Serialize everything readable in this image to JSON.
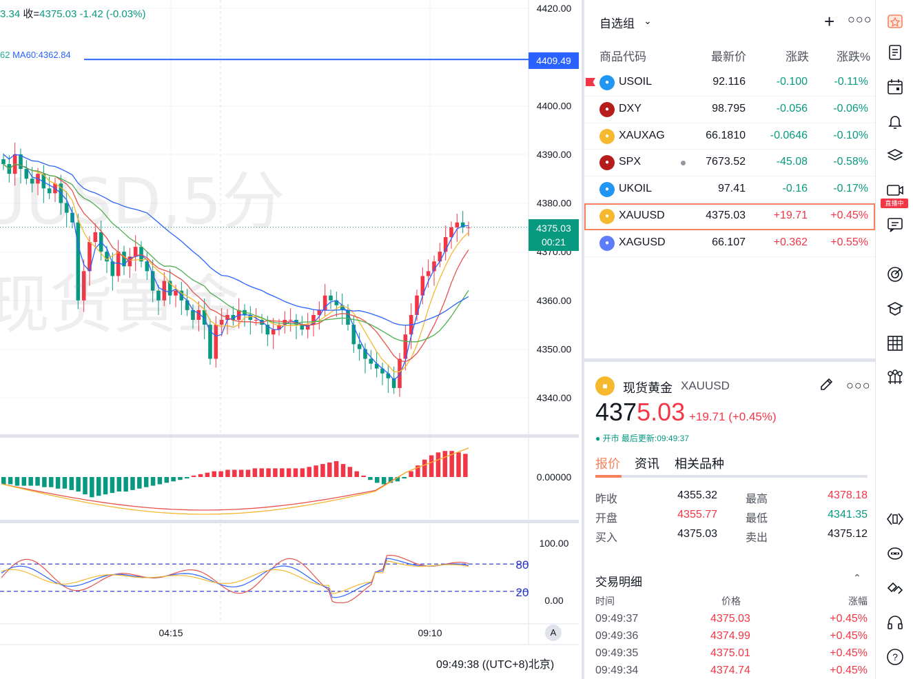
{
  "chart": {
    "legend_ohlc": "3.34 收=4375.03 -1.42 (-0.03%)",
    "legend_ohlc_parts": {
      "prefix": "3.34",
      "close_label": "收=",
      "close": "4375.03",
      "change": "-1.42",
      "change_pct": "(-0.03%)"
    },
    "legend_ma": {
      "prefix": "62",
      "ma60": "MA60:4362.84"
    },
    "watermark_symbol": "UUSD,5分",
    "watermark_name": "现货黄金",
    "ma_price_tag": "4409.49",
    "last_price_tag": "4375.03",
    "countdown_tag": "00:21",
    "price_axis_labels": [
      "4420.00",
      "4400.00",
      "4390.00",
      "4380.00",
      "4370.00",
      "4360.00",
      "4350.00",
      "4340.00"
    ],
    "macd_axis_label": "0.00000",
    "kdj_axis_labels": [
      "100.00",
      "0.00"
    ],
    "kdj_levels": [
      "80",
      "20"
    ],
    "time_labels": [
      "04:15",
      "09:10"
    ],
    "clock": "09:49:38 ((UTC+8)北京)",
    "auto_label": "A",
    "colors": {
      "up": "#f23645",
      "down": "#089981",
      "ma_blue": "#2962ff",
      "ma_yellow": "#f5b82e",
      "ma_red": "#e8504a",
      "ma_green": "#4caf50"
    }
  },
  "chart_data": {
    "type": "candlestick",
    "symbol": "XAUUSD",
    "interval": "5分",
    "ylim": [
      4335,
      4425
    ],
    "ma60_level": 4409.49,
    "last_price": 4375.03,
    "time_labels": [
      "04:15",
      "09:10"
    ],
    "candles_close": [
      4388,
      4386,
      4390,
      4387,
      4385,
      4384,
      4386,
      4383,
      4382,
      4384,
      4380,
      4378,
      4376,
      4360,
      4366,
      4372,
      4374,
      4370,
      4368,
      4365,
      4370,
      4367,
      4369,
      4371,
      4368,
      4366,
      4362,
      4360,
      4364,
      4361,
      4362,
      4360,
      4358,
      4356,
      4358,
      4355,
      4348,
      4355,
      4356,
      4357,
      4356,
      4358,
      4357,
      4356,
      4356,
      4355,
      4353,
      4354,
      4355,
      4356,
      4356,
      4355,
      4354,
      4355,
      4357,
      4358,
      4361,
      4360,
      4359,
      4358,
      4355,
      4351,
      4350,
      4348,
      4347,
      4346,
      4345,
      4344,
      4342,
      4348,
      4353,
      4357,
      4361,
      4365,
      4366,
      4368,
      4370,
      4373,
      4375,
      4376,
      4375,
      4375
    ],
    "macd_hist": [
      -0.5,
      -0.5,
      -0.6,
      -0.6,
      -0.6,
      -0.6,
      -0.7,
      -0.7,
      -0.8,
      -0.8,
      -0.9,
      -1,
      -1.2,
      -1.4,
      -1.3,
      -1.2,
      -1.1,
      -1,
      -1,
      -0.9,
      -0.8,
      -0.7,
      -0.6,
      -0.5,
      -0.4,
      -0.3,
      -0.2,
      -0.1,
      0.1,
      0.2,
      0.3,
      0.4,
      0.4,
      0.5,
      0.5,
      0.5,
      0.5,
      0.6,
      0.6,
      0.6,
      0.6,
      0.6,
      0.6,
      0.6,
      0.6,
      0.7,
      0.8,
      0.9,
      1,
      1.1,
      0.9,
      0.7,
      0.4,
      0.1,
      -0.2,
      -0.4,
      -0.5,
      -0.4,
      -0.3,
      -0.1,
      0.4,
      0.8,
      1.2,
      1.5,
      1.7,
      1.8,
      1.8,
      1.7,
      1.6
    ],
    "kdj_levels": [
      80,
      20
    ],
    "kdj_ylim": [
      0,
      100
    ]
  },
  "watchlist": {
    "title": "自选组",
    "columns": [
      "商品代码",
      "最新价",
      "涨跌",
      "涨跌%"
    ],
    "rows": [
      {
        "symbol": "USOIL",
        "last": "92.116",
        "change": "-0.100",
        "pct": "-0.11%",
        "dir": "neg",
        "icon": "oil-icon",
        "icon_color": "#2196f3",
        "flag": true
      },
      {
        "symbol": "DXY",
        "last": "98.795",
        "change": "-0.056",
        "pct": "-0.06%",
        "dir": "neg",
        "icon": "us-flag-icon",
        "icon_color": "#b71c1c"
      },
      {
        "symbol": "XAUXAG",
        "last": "66.1810",
        "change": "-0.0646",
        "pct": "-0.10%",
        "dir": "neg",
        "icon": "gold-silver-icon",
        "icon_color": "#f5b82e"
      },
      {
        "symbol": "SPX",
        "last": "7673.52",
        "change": "-45.08",
        "pct": "-0.58%",
        "dir": "neg",
        "icon": "us-flag-icon",
        "icon_color": "#b71c1c",
        "dot": true
      },
      {
        "symbol": "UKOIL",
        "last": "97.41",
        "change": "-0.16",
        "pct": "-0.17%",
        "dir": "neg",
        "icon": "oil-icon",
        "icon_color": "#2196f3"
      },
      {
        "symbol": "XAUUSD",
        "last": "4375.03",
        "change": "+19.71",
        "pct": "+0.45%",
        "dir": "pos",
        "icon": "gold-icon",
        "icon_color": "#f5b82e",
        "selected": true
      },
      {
        "symbol": "XAGUSD",
        "last": "66.107",
        "change": "+0.362",
        "pct": "+0.55%",
        "dir": "pos",
        "icon": "silver-icon",
        "icon_color": "#5c7cfa"
      }
    ]
  },
  "details": {
    "name": "现货黄金",
    "code": "XAUUSD",
    "price_main": "4375.03",
    "price_head": "437",
    "price_tail": "5.03",
    "change": "+19.71 (+0.45%)",
    "status": "● 开市 最后更新:09:49:37",
    "tabs": [
      "报价",
      "资讯",
      "相关品种"
    ],
    "quote": [
      {
        "l1": "昨收",
        "v1": "4355.32",
        "v1c": "",
        "l2": "最高",
        "v2": "4378.18",
        "v2c": "pos"
      },
      {
        "l1": "开盘",
        "v1": "4355.77",
        "v1c": "pos",
        "l2": "最低",
        "v2": "4341.35",
        "v2c": "neg"
      },
      {
        "l1": "买入",
        "v1": "4375.03",
        "v1c": "",
        "l2": "卖出",
        "v2": "4375.12",
        "v2c": ""
      }
    ],
    "trades_title": "交易明细",
    "trades_cols": [
      "时间",
      "价格",
      "涨幅"
    ],
    "trades": [
      {
        "time": "09:49:37",
        "price": "4375.03",
        "chg": "+0.45%"
      },
      {
        "time": "09:49:36",
        "price": "4374.99",
        "chg": "+0.45%"
      },
      {
        "time": "09:49:35",
        "price": "4375.01",
        "chg": "+0.45%"
      },
      {
        "time": "09:49:34",
        "price": "4374.74",
        "chg": "+0.45%"
      }
    ]
  },
  "rail": {
    "live_badge": "直播中",
    "icons": [
      "watchlist-icon",
      "news-icon",
      "calendar-icon",
      "alerts-icon",
      "layers-icon",
      "live-icon",
      "chat-icon",
      "target-icon",
      "education-icon",
      "table-icon",
      "network-icon",
      "code-icon",
      "robot-icon",
      "handshake-icon",
      "headset-icon",
      "help-icon"
    ]
  }
}
